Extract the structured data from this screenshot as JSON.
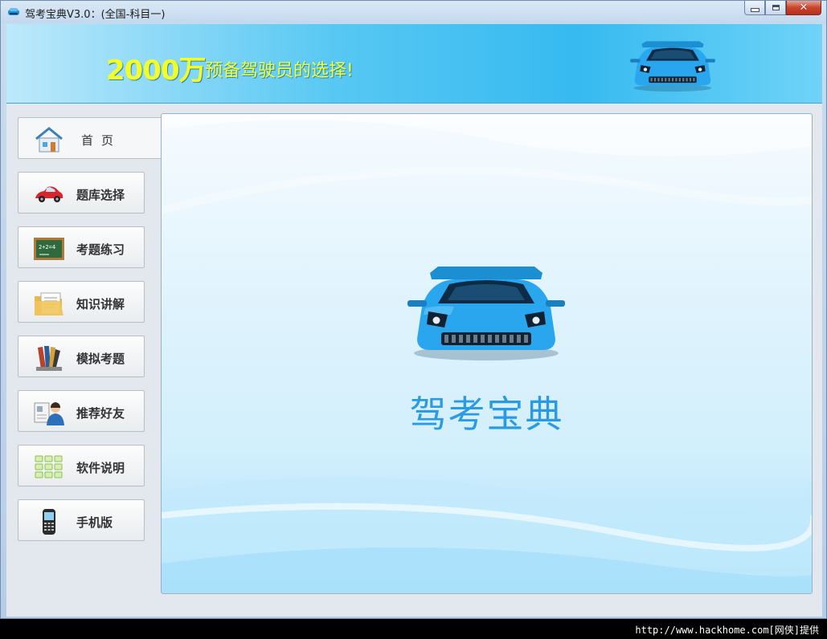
{
  "window": {
    "title": "驾考宝典V3.0：(全国-科目一)",
    "controls": [
      "minimize",
      "maximize",
      "close"
    ]
  },
  "banner": {
    "highlight": "2000万",
    "slogan": "预备驾驶员的选择!",
    "logo_icon": "sports-car-icon"
  },
  "nav": {
    "items": [
      {
        "label": "首页",
        "icon": "home-icon",
        "active": true
      },
      {
        "label": "题库选择",
        "icon": "red-car-icon",
        "active": false
      },
      {
        "label": "考题练习",
        "icon": "chalkboard-icon",
        "active": false
      },
      {
        "label": "知识讲解",
        "icon": "folder-document-icon",
        "active": false
      },
      {
        "label": "模拟考题",
        "icon": "pens-icon",
        "active": false
      },
      {
        "label": "推荐好友",
        "icon": "user-card-icon",
        "active": false
      },
      {
        "label": "软件说明",
        "icon": "flowchart-icon",
        "active": false
      },
      {
        "label": "手机版",
        "icon": "mobile-phone-icon",
        "active": false
      }
    ]
  },
  "content": {
    "title": "驾考宝典"
  },
  "watermark": "http://www.hackhome.com[网侠]提供",
  "colors": {
    "banner_text": "#f4ff23",
    "hero_text": "#2a9be2",
    "car_blue": "#1e9ee8"
  }
}
